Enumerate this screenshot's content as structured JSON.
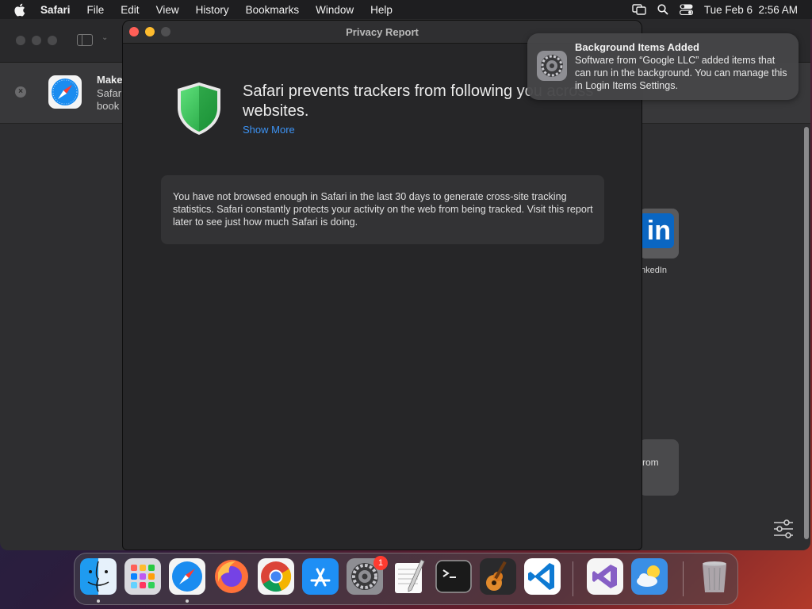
{
  "menubar": {
    "apple_icon": "apple-logo-icon",
    "app_name": "Safari",
    "items": [
      "File",
      "Edit",
      "View",
      "History",
      "Bookmarks",
      "Window",
      "Help"
    ],
    "status_icons": [
      "screen-mirroring-icon",
      "search-icon",
      "control-center-icon"
    ],
    "clock": "Tue Feb 6  2:56 AM"
  },
  "background_window": {
    "banner_title": "Make",
    "banner_line2": "Safar",
    "banner_line3": "book",
    "linkedin_label": "nkedIn",
    "linkedin_glyph": "in",
    "card_text": "rom"
  },
  "privacy_window": {
    "title": "Privacy Report",
    "headline": "Safari prevents trackers from following you across websites.",
    "show_more": "Show More",
    "info_text": "You have not browsed enough in Safari in the last 30 days to generate cross-site tracking statistics. Safari constantly protects your activity on the web from being tracked. Visit this report later to see just how much Safari is doing."
  },
  "notification": {
    "title": "Background Items Added",
    "body": "Software from “Google LLC” added items that can run in the background. You can manage this in Login Items Settings.",
    "icon": "system-settings-gear-icon"
  },
  "dock": {
    "items": [
      {
        "name": "finder-icon",
        "running": true
      },
      {
        "name": "launchpad-icon",
        "running": false
      },
      {
        "name": "safari-icon",
        "running": true
      },
      {
        "name": "firefox-icon",
        "running": false
      },
      {
        "name": "chrome-icon",
        "running": false
      },
      {
        "name": "app-store-icon",
        "running": false
      },
      {
        "name": "system-settings-icon",
        "running": false,
        "badge": "1"
      },
      {
        "name": "textedit-icon",
        "running": false
      },
      {
        "name": "terminal-icon",
        "running": false
      },
      {
        "name": "garageband-icon",
        "running": false
      },
      {
        "name": "vscode-icon",
        "running": false
      },
      {
        "name": "visual-studio-icon",
        "running": false
      },
      {
        "name": "weather-icon",
        "running": false
      },
      {
        "name": "trash-icon",
        "running": false
      }
    ]
  },
  "colors": {
    "accent_link": "#3d94f6",
    "close": "#ff5f57",
    "minimize": "#febc2e",
    "shield_green": "#34c759"
  }
}
